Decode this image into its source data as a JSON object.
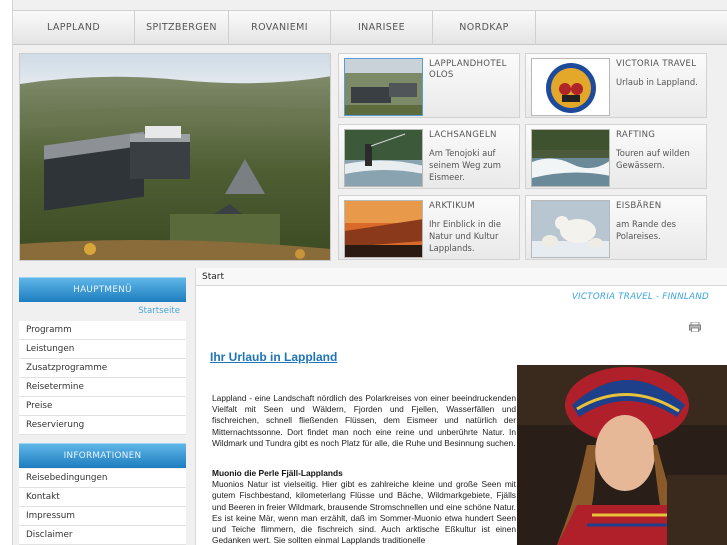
{
  "nav": {
    "items": [
      "LAPPLAND",
      "SPITZBERGEN",
      "ROVANIEMI",
      "INARISEE",
      "NORDKAP"
    ]
  },
  "cards": [
    {
      "title": "LAPPLANDHOTEL OLOS",
      "desc": ""
    },
    {
      "title": "VICTORIA TRAVEL",
      "desc": "Urlaub in Lappland."
    },
    {
      "title": "LACHSANGELN",
      "desc": "Am Tenojoki auf seinem Weg zum Eismeer."
    },
    {
      "title": "RAFTING",
      "desc": "Touren auf wilden Gewässern."
    },
    {
      "title": "ARKTIKUM",
      "desc": "Ihr Einblick in die Natur und Kultur Lapplands."
    },
    {
      "title": "EISBÄREN",
      "desc": "am Rande des Polareises."
    }
  ],
  "sidebar": {
    "main_heading": "HAUPTMENÜ",
    "home_link": "Startseite",
    "main_items": [
      "Programm",
      "Leistungen",
      "Zusatzprogramme",
      "Reisetermine",
      "Preise",
      "Reservierung"
    ],
    "info_heading": "INFORMATIONEN",
    "info_items": [
      "Reisebedingungen",
      "Kontakt",
      "Impressum",
      "Disclaimer"
    ]
  },
  "content": {
    "breadcrumb": "Start",
    "tagline": "VICTORIA TRAVEL - FINNLAND",
    "heading": "Ihr Urlaub in Lappland",
    "paragraph1": "Lappland - eine Landschaft nördlich des Polarkreises von einer beeindruckenden Vielfalt mit Seen und Wäldern, Fjorden und Fjellen, Wasserfällen und fischreichen, schnell fließenden Flüssen, dem Eismeer und natürlich der Mitternachtssonne. Dort findet man noch eine reine und unberührte Natur. In Wildmark und Tundra gibt es noch Platz für alle, die Ruhe und Besinnung suchen.",
    "subheading": "Muonio die Perle Fjäll-Lapplands",
    "paragraph2": "Muonios Natur ist vielseitig. Hier gibt es zahlreiche kleine und große Seen mit gutem Fischbestand, kilometerlang Flüsse und Bäche, Wildmarkgebiete, Fjälls und Beeren in freier Wildmark, brausende Stromschnellen und eine schöne Natur. Es ist keine Mär, wenn man erzählt, daß im Sommer-Muonio etwa hundert Seen und Teiche flimmern, die fischreich sind. Auch arktische Eßkultur ist einen Gedanken wert. Sie sollten einmal Lapplands traditionelle"
  },
  "colors": {
    "accent": "#1d7dbf",
    "link": "#1d74b8",
    "tagline": "#3aa3df"
  }
}
